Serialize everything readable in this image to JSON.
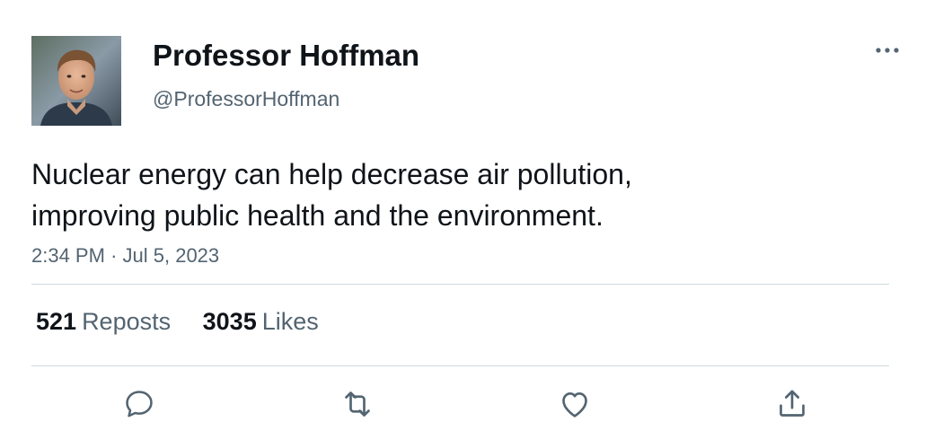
{
  "tweet": {
    "display_name": "Professor Hoffman",
    "handle": "@ProfessorHoffman",
    "text_lines": [
      "Nuclear energy can help decrease air pollution,",
      "improving public health and the environment."
    ],
    "time": "2:34 PM",
    "separator": "·",
    "date": "Jul 5, 2023",
    "stats": {
      "reposts_count": "521",
      "reposts_label": "Reposts",
      "likes_count": "3035",
      "likes_label": "Likes"
    },
    "icons": {
      "more": "more-horizontal-icon",
      "reply": "reply-icon",
      "repost": "repost-icon",
      "like": "heart-icon",
      "share": "share-icon"
    },
    "colors": {
      "text_primary": "#0f1419",
      "text_secondary": "#536471",
      "divider": "#cfd9de"
    }
  }
}
